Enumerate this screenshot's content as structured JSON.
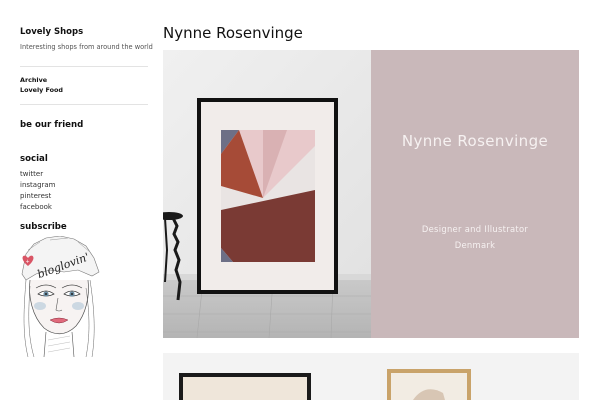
{
  "site": {
    "title": "Lovely Shops",
    "tagline": "Interesting shops from around the world"
  },
  "nav": {
    "items": [
      {
        "label": "Archive"
      },
      {
        "label": "Lovely Food"
      }
    ]
  },
  "widgets": {
    "friend_title": "be our friend",
    "social_title": "social",
    "social_links": [
      {
        "label": "twitter"
      },
      {
        "label": "instagram"
      },
      {
        "label": "pinterest"
      },
      {
        "label": "facebook"
      }
    ],
    "subscribe_title": "subscribe",
    "bloglovin_text": "bloglovin'"
  },
  "post": {
    "title": "Nynne Rosenvinge",
    "hero_name": "Nynne Rosenvinge",
    "hero_role": "Designer and Illustrator",
    "hero_country": "Denmark"
  },
  "colors": {
    "panel_bg": "#c9b8ba",
    "panel_text": "#f6f1f1"
  }
}
